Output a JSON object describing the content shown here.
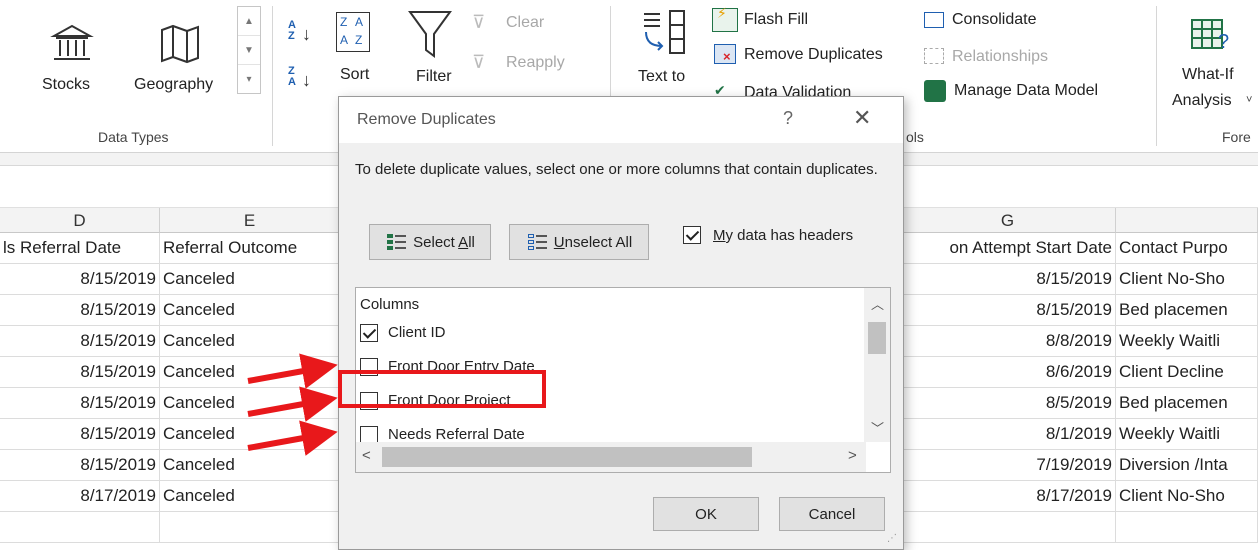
{
  "ribbon": {
    "data_types": {
      "stocks": "Stocks",
      "geography": "Geography",
      "group": "Data Types"
    },
    "sort_filter": {
      "sort": "Sort",
      "filter": "Filter",
      "clear": "Clear",
      "reapply": "Reapply"
    },
    "data_tools": {
      "text_to_columns_line1": "Text to",
      "flash_fill": "Flash Fill",
      "remove_duplicates": "Remove Duplicates",
      "data_validation": "Data Validation",
      "consolidate": "Consolidate",
      "relationships": "Relationships",
      "manage_data_model": "Manage Data Model",
      "group_partial": "ols"
    },
    "forecast": {
      "what_if_line1": "What-If",
      "what_if_line2": "Analysis",
      "group_partial": "Fore"
    }
  },
  "grid": {
    "col_d": "D",
    "col_e": "E",
    "col_g": "G",
    "header_d": "ls Referral Date",
    "header_e": "Referral Outcome",
    "header_g": "on Attempt Start Date",
    "header_h": "Contact Purpo",
    "rows": [
      {
        "d": "8/15/2019",
        "e": "Canceled",
        "g": "8/15/2019",
        "h": "Client No-Sho"
      },
      {
        "d": "8/15/2019",
        "e": "Canceled",
        "g": "8/15/2019",
        "h": "Bed placemen"
      },
      {
        "d": "8/15/2019",
        "e": "Canceled",
        "g": "8/8/2019",
        "h": "Weekly Waitli"
      },
      {
        "d": "8/15/2019",
        "e": "Canceled",
        "g": "8/6/2019",
        "h": "Client Decline"
      },
      {
        "d": "8/15/2019",
        "e": "Canceled",
        "g": "8/5/2019",
        "h": "Bed placemen"
      },
      {
        "d": "8/15/2019",
        "e": "Canceled",
        "g": "8/1/2019",
        "h": "Weekly Waitli"
      },
      {
        "d": "8/15/2019",
        "e": "Canceled",
        "g": "7/19/2019",
        "h": "Diversion /Inta"
      },
      {
        "d": "8/17/2019",
        "e": "Canceled",
        "g": "8/17/2019",
        "h": "Client No-Sho"
      }
    ]
  },
  "dialog": {
    "title": "Remove Duplicates",
    "help": "?",
    "close": "✕",
    "description": "To delete duplicate values, select one or more columns that contain duplicates.",
    "select_all_pre": "Select ",
    "select_all_u": "A",
    "select_all_post": "ll",
    "unselect_all_u": "U",
    "unselect_all_post": "nselect All",
    "headers_u": "M",
    "headers_post": "y data has headers",
    "headers_checked": true,
    "columns_header": "Columns",
    "columns": [
      {
        "label": "Client ID",
        "checked": true
      },
      {
        "label": "Front Door Entry Date",
        "checked": false
      },
      {
        "label": "Front Door Project",
        "checked": false
      },
      {
        "label": "Needs Referral Date",
        "checked": false
      }
    ],
    "ok": "OK",
    "cancel": "Cancel"
  },
  "colors": {
    "annotation_red": "#e8181b",
    "excel_green": "#217346"
  }
}
